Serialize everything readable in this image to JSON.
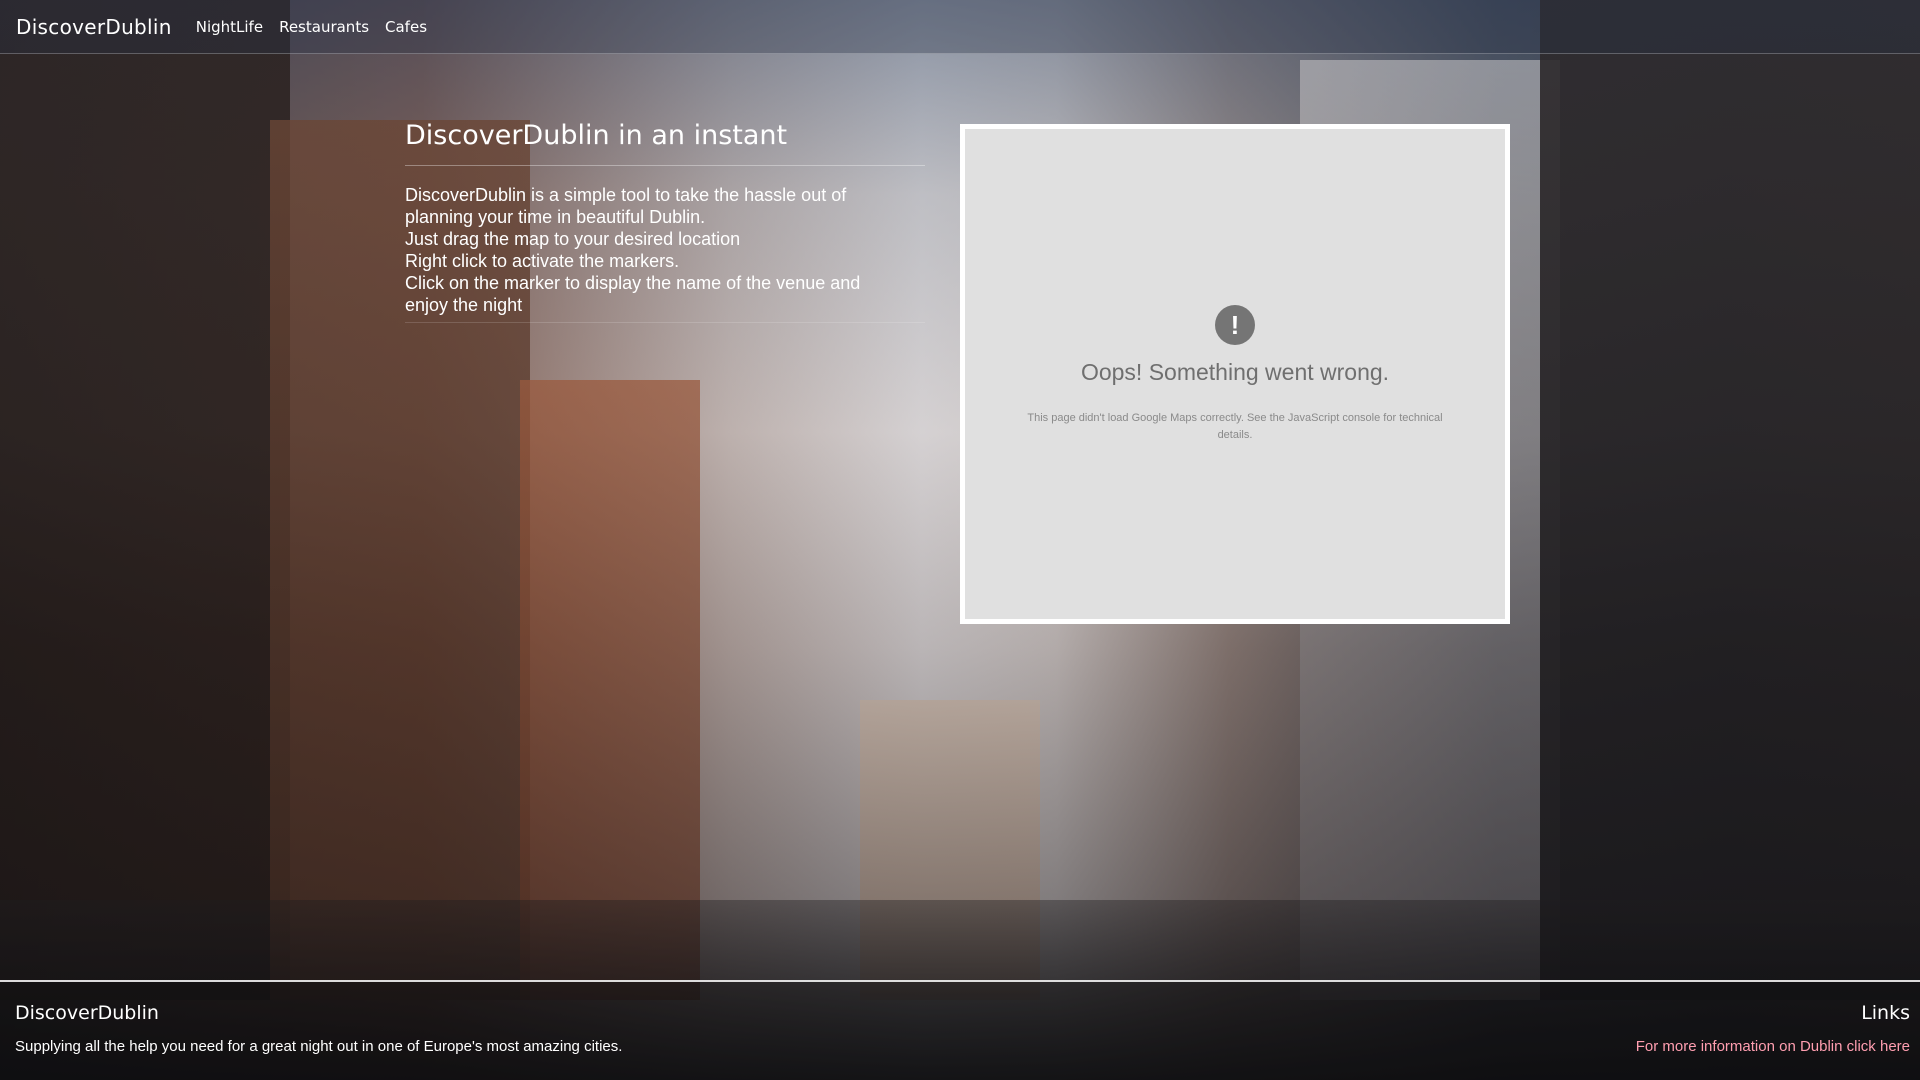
{
  "navbar": {
    "brand": "DiscoverDublin",
    "links": [
      {
        "label": "NightLife"
      },
      {
        "label": "Restaurants"
      },
      {
        "label": "Cafes"
      }
    ]
  },
  "intro": {
    "title": "DiscoverDublin in an instant",
    "lines": [
      "DiscoverDublin is a simple tool to take the hassle out of",
      "planning your time in beautiful Dublin.",
      "Just drag the map to your desired location",
      "Right click to activate the markers.",
      "Click on the marker to display the name of the venue and",
      "enjoy the night"
    ]
  },
  "map_error": {
    "icon": "!",
    "icon_name": "error-icon",
    "title": "Oops! Something went wrong.",
    "detail": "This page didn't load Google Maps correctly. See the JavaScript console for technical details."
  },
  "footer": {
    "brand": "DiscoverDublin",
    "tagline": "Supplying all the help you need for a great night out in one of Europe's most amazing cities.",
    "links_title": "Links",
    "link_label": "For more information on Dublin click here",
    "link_color": "#ff9eb0"
  }
}
